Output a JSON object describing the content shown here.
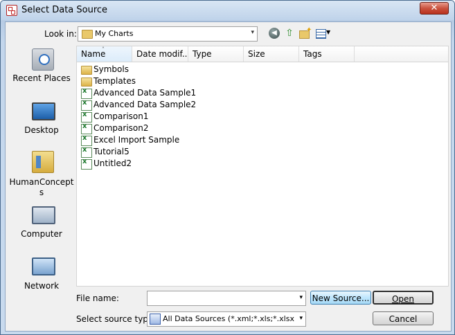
{
  "window": {
    "title": "Select Data Source",
    "close_glyph": "✕"
  },
  "toolbar": {
    "lookin_label": "Look in:",
    "lookin_value": "My Charts",
    "dropdown_glyph": "▾",
    "icons": [
      "back-icon",
      "up-folder-icon",
      "new-folder-icon",
      "views-menu-icon"
    ]
  },
  "places": [
    {
      "label": "Recent Places",
      "icon": "recent-places-icon"
    },
    {
      "label": "Desktop",
      "icon": "desktop-icon"
    },
    {
      "label": "HumanConcepts",
      "icon": "user-folder-icon"
    },
    {
      "label": "Computer",
      "icon": "computer-icon"
    },
    {
      "label": "Network",
      "icon": "network-icon"
    }
  ],
  "filelist": {
    "columns": [
      "Name",
      "Date modif...",
      "Type",
      "Size",
      "Tags"
    ],
    "sort_indicator": "˄",
    "items": [
      {
        "name": "Symbols",
        "kind": "folder"
      },
      {
        "name": "Templates",
        "kind": "folder"
      },
      {
        "name": "Advanced Data Sample1",
        "kind": "excel"
      },
      {
        "name": "Advanced Data Sample2",
        "kind": "excel"
      },
      {
        "name": "Comparison1",
        "kind": "excel"
      },
      {
        "name": "Comparison2",
        "kind": "excel"
      },
      {
        "name": "Excel Import Sample",
        "kind": "excel"
      },
      {
        "name": "Tutorial5",
        "kind": "excel"
      },
      {
        "name": "Untitled2",
        "kind": "excel"
      }
    ]
  },
  "form": {
    "filename_label": "File name:",
    "filename_value": "",
    "type_label": "Select source type:",
    "type_value": "All Data Sources (*.xml;*.xls;*.xlsx;*.c"
  },
  "buttons": {
    "new_source": "New Source...",
    "open": "Open",
    "cancel": "Cancel"
  }
}
